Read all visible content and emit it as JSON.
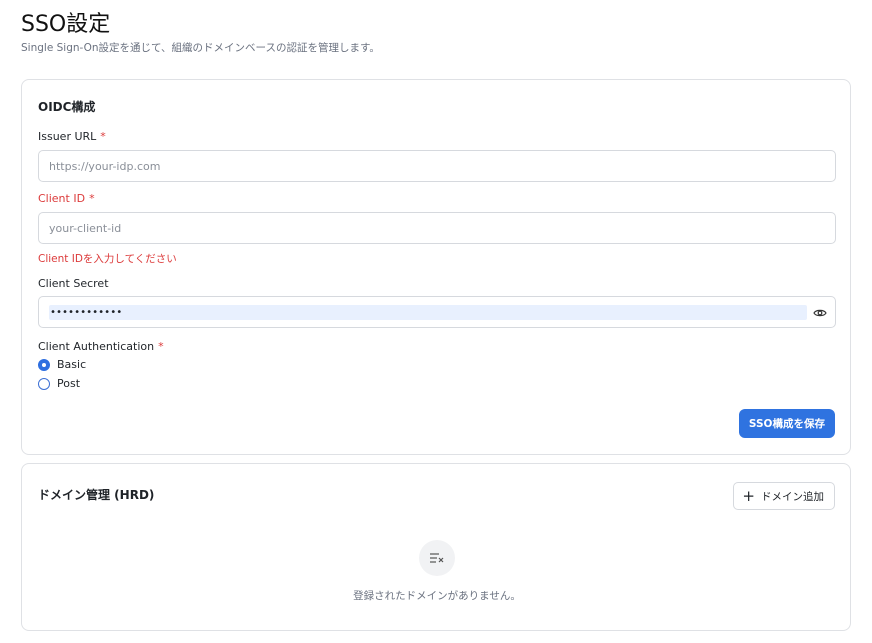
{
  "page": {
    "title": "SSO設定",
    "subtitle": "Single Sign-On設定を通じて、組織のドメインベースの認証を管理します。"
  },
  "oidc": {
    "title": "OIDC構成",
    "issuer": {
      "label": "Issuer URL",
      "required": "*",
      "placeholder": "https://your-idp.com",
      "value": ""
    },
    "client_id": {
      "label": "Client ID",
      "required": "*",
      "placeholder": "your-client-id",
      "value": "",
      "error": "Client IDを入力してください"
    },
    "client_secret": {
      "label": "Client Secret",
      "masked_value": "••••••••••••"
    },
    "auth": {
      "label": "Client Authentication",
      "required": "*",
      "options": [
        {
          "label": "Basic",
          "checked": true
        },
        {
          "label": "Post",
          "checked": false
        }
      ]
    },
    "save_label": "SSO構成を保存"
  },
  "domains": {
    "title": "ドメイン管理 (HRD)",
    "add_label": "ドメイン追加",
    "empty_text": "登録されたドメインがありません。"
  },
  "colors": {
    "primary": "#2f73e0",
    "error": "#dc3b3b",
    "autofill": "#e8f0fe"
  },
  "icons": [
    "eye-icon",
    "plus-icon",
    "empty-list-icon"
  ]
}
